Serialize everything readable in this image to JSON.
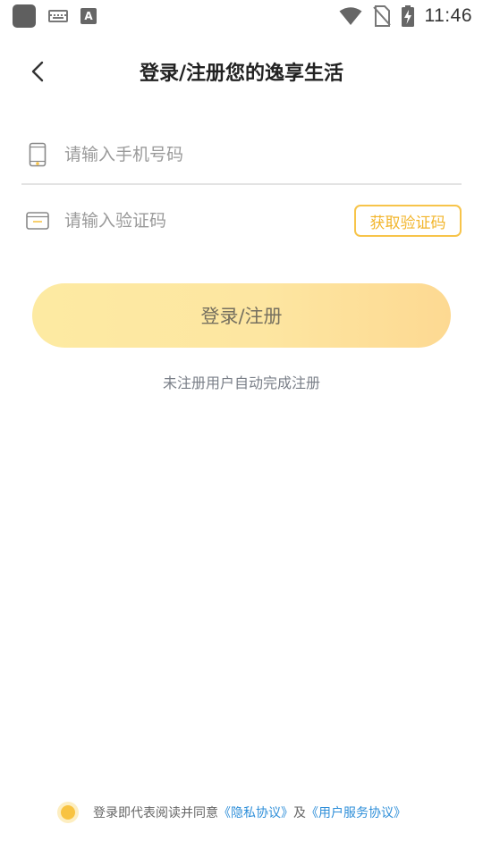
{
  "status_bar": {
    "time": "11:46",
    "icons": [
      "app-icon",
      "keyboard-icon",
      "font-a-icon",
      "wifi-icon",
      "no-sim-icon",
      "battery-charging-icon"
    ],
    "a_glyph": "A"
  },
  "header": {
    "title": "登录/注册您的逸享生活",
    "back_icon": "chevron-left-icon"
  },
  "form": {
    "phone": {
      "placeholder": "请输入手机号码",
      "value": "",
      "icon": "phone-icon"
    },
    "code": {
      "placeholder": "请输入验证码",
      "value": "",
      "icon": "card-icon"
    },
    "get_code_label": "获取验证码"
  },
  "login_button": {
    "label": "登录/注册"
  },
  "hint": "未注册用户自动完成注册",
  "agreement": {
    "prefix": "登录即代表阅读并同意",
    "privacy_link": "《隐私协议》",
    "conjunction": "及",
    "service_link": "《用户服务协议》",
    "checked": true
  },
  "colors": {
    "accent": "#f7c44a",
    "button_start": "#fdeaa2",
    "button_end": "#fdd992",
    "link": "#2f8fd9"
  }
}
